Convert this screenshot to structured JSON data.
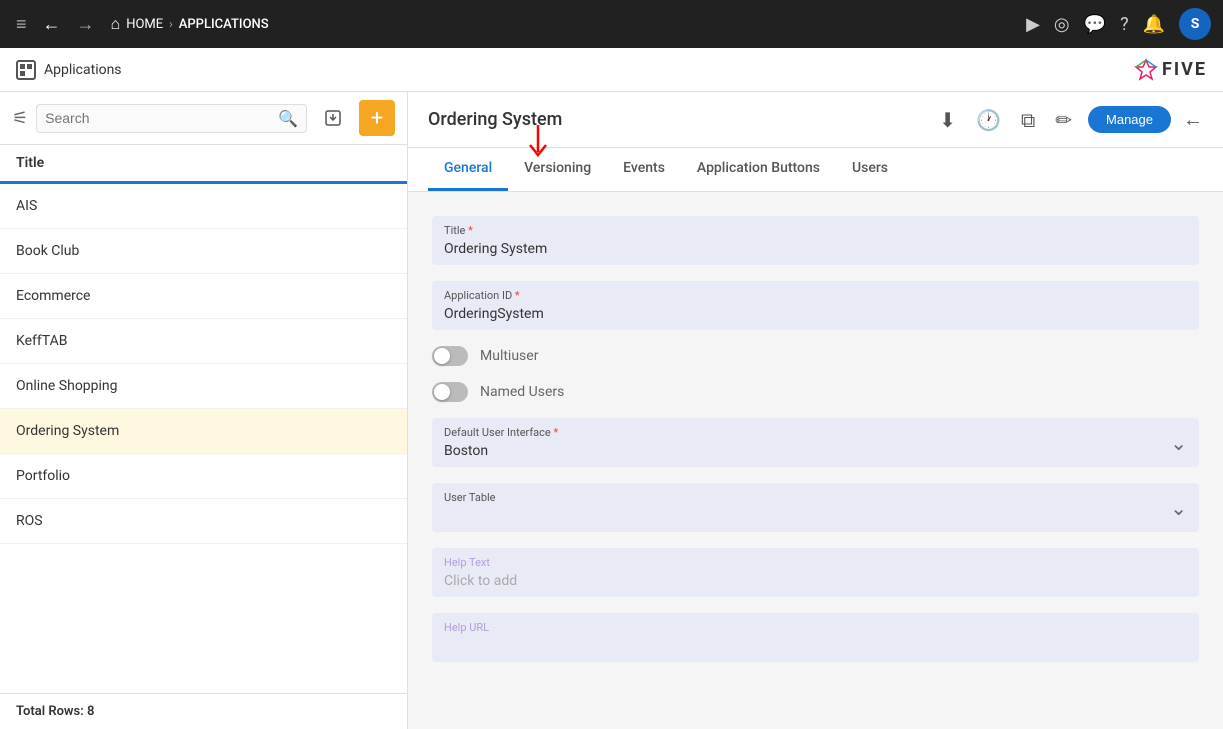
{
  "topnav": {
    "menu_icon": "≡",
    "back_icon": "←",
    "forward_icon": "→",
    "home_label": "HOME",
    "separator": "›",
    "apps_label": "APPLICATIONS",
    "play_icon": "▶",
    "broadcast_icon": "◉",
    "chat_icon": "💬",
    "help_icon": "?",
    "bell_icon": "🔔",
    "avatar_label": "S"
  },
  "subheader": {
    "app_title": "Applications",
    "logo_text": "FIVE"
  },
  "left_panel": {
    "search_placeholder": "Search",
    "list_header": "Title",
    "items": [
      {
        "label": "AIS",
        "active": false
      },
      {
        "label": "Book Club",
        "active": false
      },
      {
        "label": "Ecommerce",
        "active": false
      },
      {
        "label": "KeffTAB",
        "active": false
      },
      {
        "label": "Online Shopping",
        "active": false
      },
      {
        "label": "Ordering System",
        "active": true
      },
      {
        "label": "Portfolio",
        "active": false
      },
      {
        "label": "ROS",
        "active": false
      }
    ],
    "footer": "Total Rows: 8"
  },
  "right_panel": {
    "title": "Ordering System",
    "manage_label": "Manage",
    "tabs": [
      {
        "label": "General",
        "active": true
      },
      {
        "label": "Versioning",
        "active": false
      },
      {
        "label": "Events",
        "active": false
      },
      {
        "label": "Application Buttons",
        "active": false
      },
      {
        "label": "Users",
        "active": false
      }
    ],
    "form": {
      "title_label": "Title",
      "title_required": true,
      "title_value": "Ordering System",
      "app_id_label": "Application ID",
      "app_id_required": true,
      "app_id_value": "OrderingSystem",
      "multiuser_label": "Multiuser",
      "named_users_label": "Named Users",
      "default_ui_label": "Default User Interface",
      "default_ui_required": true,
      "default_ui_value": "Boston",
      "user_table_label": "User Table",
      "user_table_value": "",
      "help_text_label": "Help Text",
      "help_text_placeholder": "Click to add",
      "help_url_label": "Help URL"
    }
  }
}
